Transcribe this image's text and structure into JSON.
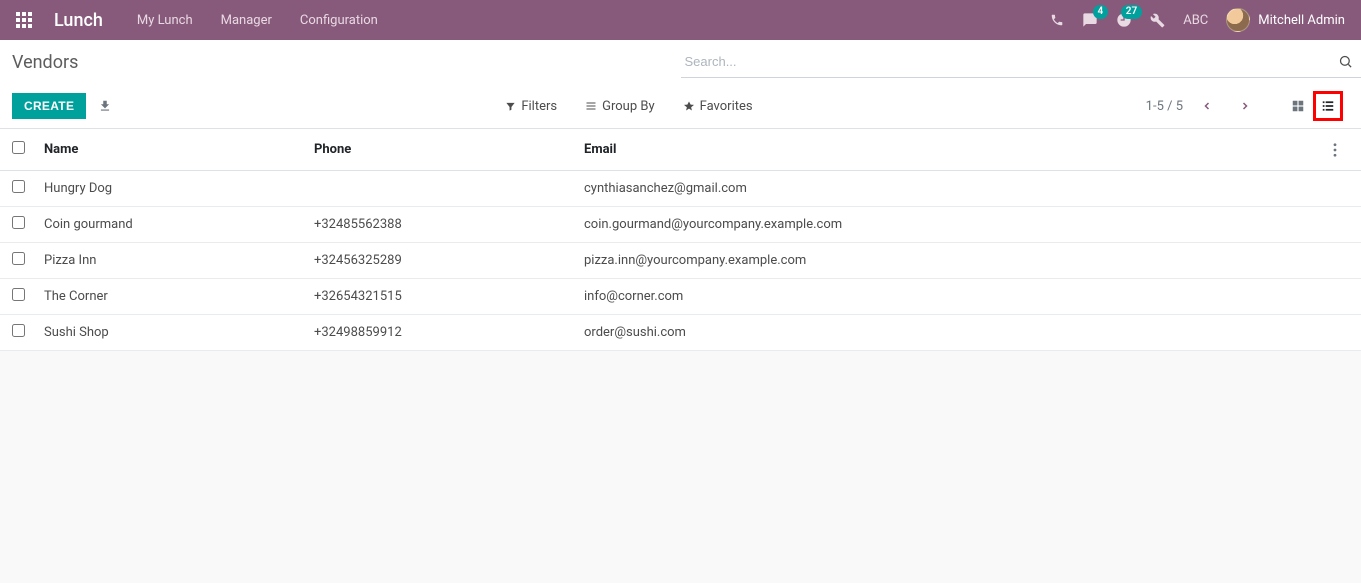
{
  "navbar": {
    "brand": "Lunch",
    "menu": [
      "My Lunch",
      "Manager",
      "Configuration"
    ],
    "messages_badge": "4",
    "activities_badge": "27",
    "company": "ABC",
    "user": "Mitchell Admin"
  },
  "control_panel": {
    "title": "Vendors",
    "search_placeholder": "Search...",
    "create_label": "CREATE",
    "filters_label": "Filters",
    "groupby_label": "Group By",
    "favorites_label": "Favorites",
    "pager_text": "1-5 / 5"
  },
  "table": {
    "headers": {
      "name": "Name",
      "phone": "Phone",
      "email": "Email"
    },
    "rows": [
      {
        "name": "Hungry Dog",
        "phone": "",
        "email": "cynthiasanchez@gmail.com"
      },
      {
        "name": "Coin gourmand",
        "phone": "+32485562388",
        "email": "coin.gourmand@yourcompany.example.com"
      },
      {
        "name": "Pizza Inn",
        "phone": "+32456325289",
        "email": "pizza.inn@yourcompany.example.com"
      },
      {
        "name": "The Corner",
        "phone": "+32654321515",
        "email": "info@corner.com"
      },
      {
        "name": "Sushi Shop",
        "phone": "+32498859912",
        "email": "order@sushi.com"
      }
    ]
  }
}
